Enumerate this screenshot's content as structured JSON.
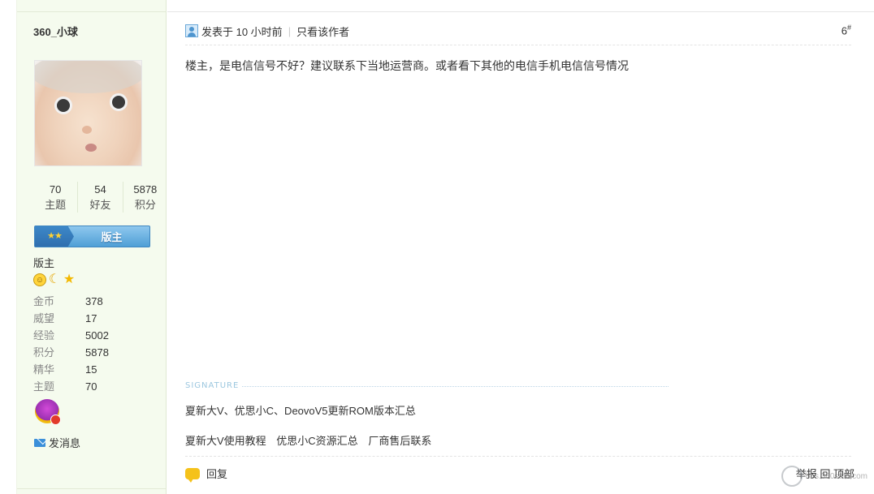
{
  "user": {
    "name": "360_小球",
    "stats": [
      {
        "value": "70",
        "label": "主题"
      },
      {
        "value": "54",
        "label": "好友"
      },
      {
        "value": "5878",
        "label": "积分"
      }
    ],
    "rank_stars": "★★",
    "rank_title": "版主",
    "group": "版主",
    "medals": [
      "smiley-medal-icon",
      "moon-medal-icon",
      "star-medal-icon"
    ],
    "profile": [
      {
        "key": "金币",
        "value": "378"
      },
      {
        "key": "威望",
        "value": "17"
      },
      {
        "key": "经验",
        "value": "5002"
      },
      {
        "key": "积分",
        "value": "5878"
      },
      {
        "key": "精华",
        "value": "15"
      },
      {
        "key": "主题",
        "value": "70"
      }
    ],
    "send_message": "发消息"
  },
  "post": {
    "posted_time": "发表于 10 小时前",
    "separator": "|",
    "only_author": "只看该作者",
    "floor": "6",
    "floor_mark": "#",
    "content": "楼主，是电信信号不好？建议联系下当地运营商。或者看下其他的电信手机电信信号情况",
    "signature_label": "SIGNATURE",
    "signature_line1": "夏新大V、优思小C、DeovoV5更新ROM版本汇总",
    "signature_line2": [
      "夏新大V使用教程",
      "优思小C资源汇总",
      "厂商售后联系"
    ],
    "reply": "回复",
    "actions": "举报  回 顶部",
    "watermark": "bbs.360safe.com"
  }
}
